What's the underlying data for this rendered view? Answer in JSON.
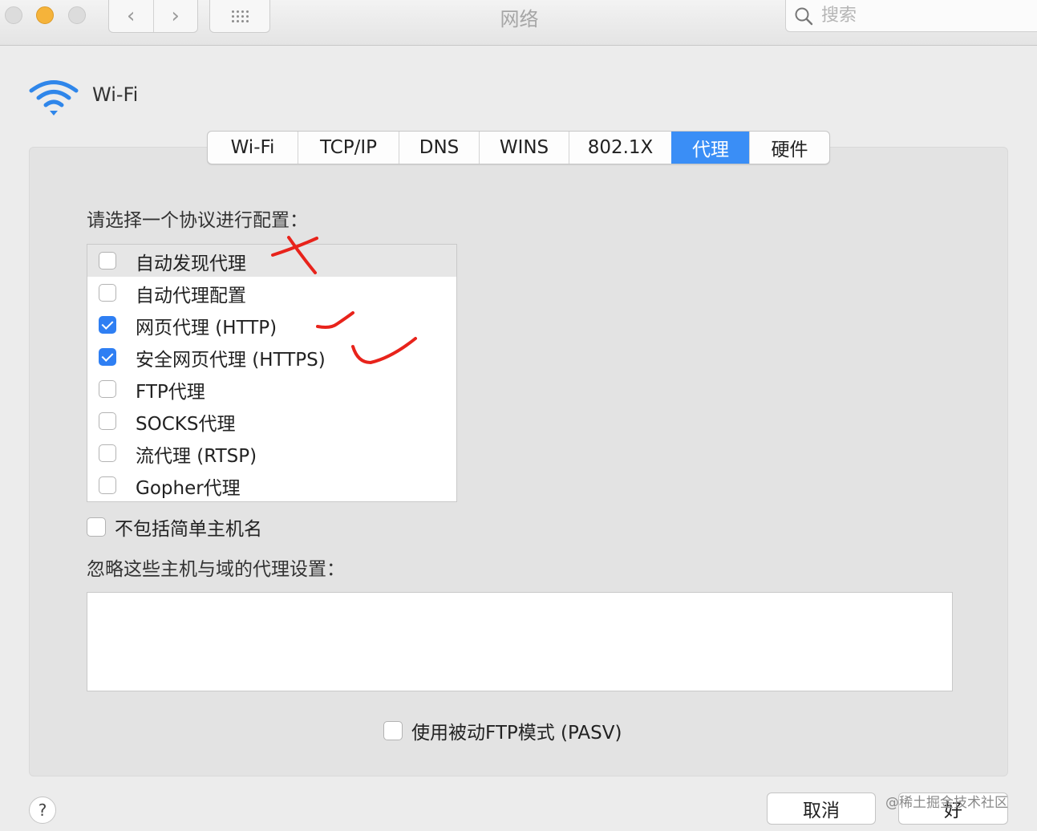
{
  "window": {
    "title": "网络",
    "search_placeholder": "搜索"
  },
  "toolbar": {
    "back_glyph": "‹",
    "forward_glyph": "›"
  },
  "header": {
    "service_name": "Wi-Fi",
    "icon": "wifi-icon"
  },
  "tabs": [
    {
      "label": "Wi-Fi",
      "active": false
    },
    {
      "label": "TCP/IP",
      "active": false
    },
    {
      "label": "DNS",
      "active": false
    },
    {
      "label": "WINS",
      "active": false
    },
    {
      "label": "802.1X",
      "active": false
    },
    {
      "label": "代理",
      "active": true
    },
    {
      "label": "硬件",
      "active": false
    }
  ],
  "proxy": {
    "protocol_prompt": "请选择一个协议进行配置：",
    "protocols": [
      {
        "label": "自动发现代理",
        "checked": false,
        "selected": true
      },
      {
        "label": "自动代理配置",
        "checked": false,
        "selected": false
      },
      {
        "label": "网页代理 (HTTP)",
        "checked": true,
        "selected": false
      },
      {
        "label": "安全网页代理 (HTTPS)",
        "checked": true,
        "selected": false
      },
      {
        "label": "FTP代理",
        "checked": false,
        "selected": false
      },
      {
        "label": "SOCKS代理",
        "checked": false,
        "selected": false
      },
      {
        "label": "流代理 (RTSP)",
        "checked": false,
        "selected": false
      },
      {
        "label": "Gopher代理",
        "checked": false,
        "selected": false
      }
    ],
    "exclude_simple_hostnames": {
      "label": "不包括简单主机名",
      "checked": false
    },
    "bypass_label": "忽略这些主机与域的代理设置：",
    "bypass_value": "",
    "passive_ftp": {
      "label": "使用被动FTP模式 (PASV)",
      "checked": false
    }
  },
  "footer": {
    "help_label": "?",
    "cancel_label": "取消",
    "ok_label": "好"
  },
  "watermark": "@稀土掘金技术社区",
  "colors": {
    "accent": "#3a8ef6",
    "annotation": "#e8231b"
  }
}
